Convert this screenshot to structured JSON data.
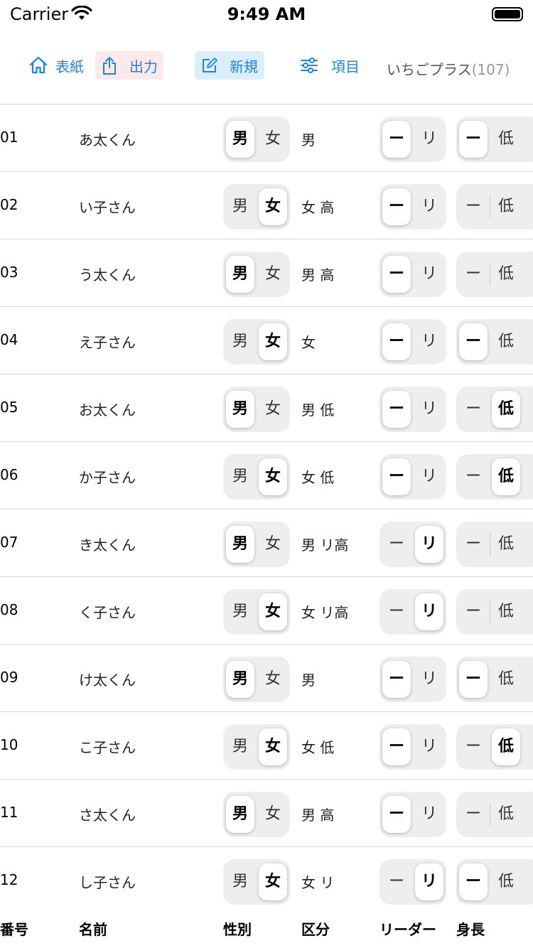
{
  "status": {
    "carrier": "Carrier",
    "time": "9:49 AM"
  },
  "toolbar": {
    "cover": "表紙",
    "export": "出力",
    "new": "新規",
    "items": "項目",
    "class_name": "いちごプラス",
    "class_count": "(107)"
  },
  "segment_labels": {
    "sex": [
      "男",
      "女"
    ],
    "leader": [
      "ー",
      "リ"
    ],
    "height": [
      "ー",
      "低"
    ]
  },
  "rows": [
    {
      "no": "01",
      "name": "あ太くん",
      "sex": "男",
      "kubun": "男",
      "leader": "ー",
      "height": "ー"
    },
    {
      "no": "02",
      "name": "い子さん",
      "sex": "女",
      "kubun": "女 高",
      "leader": "ー",
      "height": ""
    },
    {
      "no": "03",
      "name": "う太くん",
      "sex": "男",
      "kubun": "男 高",
      "leader": "ー",
      "height": ""
    },
    {
      "no": "04",
      "name": "え子さん",
      "sex": "女",
      "kubun": "女",
      "leader": "ー",
      "height": "ー"
    },
    {
      "no": "05",
      "name": "お太くん",
      "sex": "男",
      "kubun": "男 低",
      "leader": "ー",
      "height": "低"
    },
    {
      "no": "06",
      "name": "か子さん",
      "sex": "女",
      "kubun": "女 低",
      "leader": "ー",
      "height": "低"
    },
    {
      "no": "07",
      "name": "き太くん",
      "sex": "男",
      "kubun": "男 リ高",
      "leader": "リ",
      "height": ""
    },
    {
      "no": "08",
      "name": "く子さん",
      "sex": "女",
      "kubun": "女 リ高",
      "leader": "リ",
      "height": ""
    },
    {
      "no": "09",
      "name": "け太くん",
      "sex": "男",
      "kubun": "男",
      "leader": "ー",
      "height": "ー"
    },
    {
      "no": "10",
      "name": "こ子さん",
      "sex": "女",
      "kubun": "女 低",
      "leader": "ー",
      "height": "低"
    },
    {
      "no": "11",
      "name": "さ太くん",
      "sex": "男",
      "kubun": "男 高",
      "leader": "ー",
      "height": ""
    },
    {
      "no": "12",
      "name": "し子さん",
      "sex": "女",
      "kubun": "女 リ",
      "leader": "リ",
      "height": "ー"
    }
  ],
  "footer": {
    "number": "番号",
    "name": "名前",
    "sex": "性別",
    "kubun": "区分",
    "leader": "リーダー",
    "height": "身長"
  },
  "colors": {
    "accent": "#1a84e6",
    "export_bg": "#fde8ea",
    "new_bg": "#dbeefc",
    "segment_bg": "#eeeeef"
  }
}
